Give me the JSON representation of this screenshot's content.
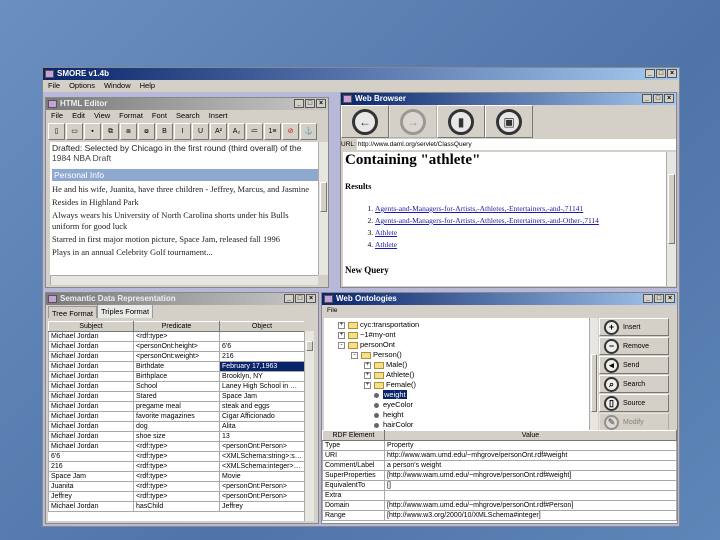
{
  "app": {
    "title": "SMORE v1.4b",
    "menu": [
      "File",
      "Options",
      "Window",
      "Help"
    ]
  },
  "editor": {
    "title": "HTML Editor",
    "menu": [
      "File",
      "Edit",
      "View",
      "Format",
      "Font",
      "Search",
      "Insert"
    ],
    "toolbar": [
      "new",
      "open",
      "save",
      "copy",
      "paste",
      "cut",
      "B",
      "I",
      "U",
      "A²",
      "A₂",
      "≔",
      "1≡",
      "⊘",
      "⚓"
    ],
    "top_line": "Drafted: Selected by Chicago in the first round (third overall) of the",
    "draft_line": "1984 NBA Draft",
    "section": "Personal Info",
    "paragraphs": [
      "He and his wife, Juanita, have three children - Jeffrey, Marcus, and Jasmine",
      "Resides in Highland Park",
      "Always wears his University of North Carolina shorts under his Bulls uniform for good luck",
      "Starred in first major motion picture, Space Jam, released fall 1996",
      "Plays in an annual Celebrity Golf tournament..."
    ]
  },
  "browser": {
    "title": "Web Browser",
    "buttons": [
      "back",
      "forward",
      "reload",
      "home"
    ],
    "url_label": "URL:",
    "url": "http://www.daml.org/servlet/ClassQuery",
    "heading": "Containing \"athlete\"",
    "results_label": "Results",
    "results": [
      "Agents-and-Managers-for-Artists,-Athletes,-Entertainers,-and-,71141",
      "Agents-and-Managers-for-Artists,-Athletes,-Entertainers,-and-Other-,7114",
      "Athlete",
      "Athlete"
    ],
    "new_query": "New Query"
  },
  "semantic": {
    "title": "Semantic Data Representation",
    "tabs": [
      "Tree Format",
      "Triples Format"
    ],
    "active_tab": 1,
    "columns": [
      "Subject",
      "Predicate",
      "Object"
    ],
    "selected_row": 3,
    "rows": [
      [
        "Michael Jordan",
        "<rdf:type>",
        ""
      ],
      [
        "Michael Jordan",
        "<personOnt:height>",
        "6'6"
      ],
      [
        "Michael Jordan",
        "<personOnt:weight>",
        "216"
      ],
      [
        "Michael Jordan",
        "Birthdate",
        "February 17,1963"
      ],
      [
        "Michael Jordan",
        "Birthplace",
        "Brooklyn, NY"
      ],
      [
        "Michael Jordan",
        "School",
        "Laney High School in Wil..."
      ],
      [
        "Michael Jordan",
        "Stared",
        "Space Jam"
      ],
      [
        "Michael Jordan",
        "pregame meal",
        "steak and eggs"
      ],
      [
        "Michael Jordan",
        "favorite magazines",
        "Cigar Afficionado"
      ],
      [
        "Michael Jordan",
        "dog",
        "Alita"
      ],
      [
        "Michael Jordan",
        "shoe size",
        "13"
      ],
      [
        "Michael Jordan",
        "<rdf:type>",
        "<personOnt:Person>"
      ],
      [
        "6'6",
        "<rdf:type>",
        "<XMLSchema:string>:stri..."
      ],
      [
        "216",
        "<rdf:type>",
        "<XMLSchema:integer>:in..."
      ],
      [
        "Space Jam",
        "<rdf:type>",
        "Movie"
      ],
      [
        "Juanita",
        "<rdf:type>",
        "<personOnt:Person>"
      ],
      [
        "Jeffrey",
        "<rdf:type>",
        "<personOnt:Person>"
      ],
      [
        "Michael Jordan",
        "hasChild",
        "Jeffrey"
      ]
    ]
  },
  "ontologies": {
    "title": "Web Ontologies",
    "menu": [
      "File"
    ],
    "tree": [
      {
        "label": "cyc:transportation",
        "level": 0,
        "kind": "folder",
        "toggle": "+"
      },
      {
        "label": "~1#my-ont",
        "level": 0,
        "kind": "folder",
        "toggle": "+"
      },
      {
        "label": "personOnt",
        "level": 0,
        "kind": "folder",
        "toggle": "-"
      },
      {
        "label": "Person()",
        "level": 1,
        "kind": "folder",
        "toggle": "-"
      },
      {
        "label": "Male()",
        "level": 2,
        "kind": "folder",
        "toggle": "+"
      },
      {
        "label": "Athlete()",
        "level": 2,
        "kind": "folder",
        "toggle": "+"
      },
      {
        "label": "Female()",
        "level": 2,
        "kind": "folder",
        "toggle": "+"
      },
      {
        "label": "weight",
        "level": 2,
        "kind": "leaf",
        "selected": true
      },
      {
        "label": "eyeColor",
        "level": 2,
        "kind": "leaf"
      },
      {
        "label": "height",
        "level": 2,
        "kind": "leaf"
      },
      {
        "label": "hairColor",
        "level": 2,
        "kind": "leaf"
      }
    ],
    "buttons": [
      {
        "label": "Insert",
        "icon": "+"
      },
      {
        "label": "Remove",
        "icon": "−"
      },
      {
        "label": "Send",
        "icon": "◂"
      },
      {
        "label": "Search",
        "icon": "⌕"
      },
      {
        "label": "Source",
        "icon": "▯"
      },
      {
        "label": "Modify",
        "icon": "✎",
        "disabled": true
      }
    ],
    "columns": [
      "RDF Element",
      "Value"
    ],
    "rows": [
      [
        "Type",
        "Property"
      ],
      [
        "URI",
        "http://www.wam.umd.edu/~mhgrove/personOnt.rdf#weight"
      ],
      [
        "Comment/Label",
        "a person's weight"
      ],
      [
        "SuperProperties",
        "[http://www.wam.umd.edu/~mhgrove/personOnt.rdf#weight]"
      ],
      [
        "EquivalentTo",
        "[]"
      ],
      [
        "Extra",
        ""
      ],
      [
        "Domain",
        "[http://www.wam.umd.edu/~mhgrove/personOnt.rdf#Person]"
      ],
      [
        "Range",
        "[http://www.w3.org/2000/10/XMLSchema#integer]"
      ]
    ]
  }
}
